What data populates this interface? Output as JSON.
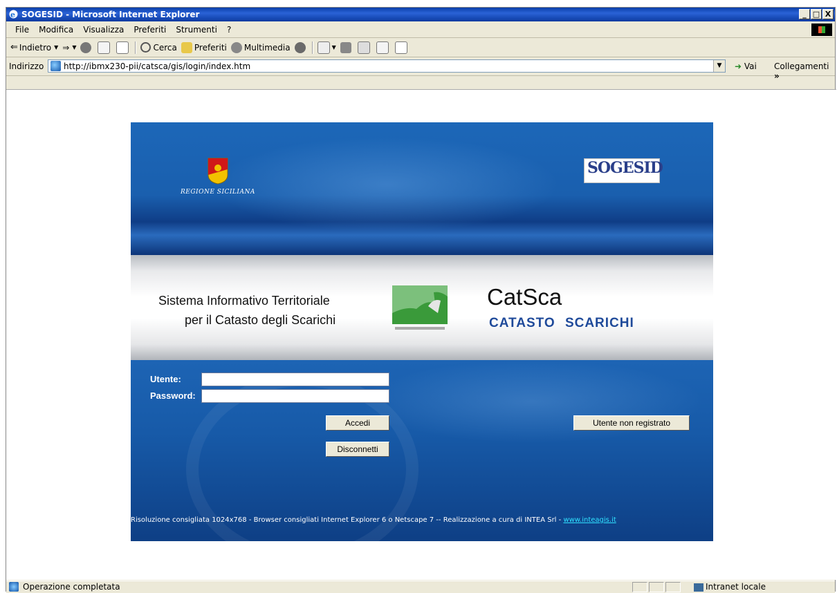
{
  "window": {
    "title": "SOGESID - Microsoft Internet Explorer",
    "controls": [
      "_",
      "□",
      "X"
    ]
  },
  "menu": [
    "File",
    "Modifica",
    "Visualizza",
    "Preferiti",
    "Strumenti",
    "?"
  ],
  "toolbar": {
    "back": "Indietro",
    "search": "Cerca",
    "favorites": "Preferiti",
    "media": "Multimedia"
  },
  "address": {
    "label": "Indirizzo",
    "url": "http://ibmx230-pii/catsca/gis/login/index.htm",
    "go": "Vai",
    "links": "Collegamenti"
  },
  "login": {
    "region_label": "REGIONE SICILIANA",
    "sogesid_logo": "SOGESID",
    "system_line1": "Sistema Informativo Territoriale",
    "system_line2": "per il Catasto degli Scarichi",
    "app_name": "CatSca",
    "app_subtitle": "CATASTO SCARICHI",
    "user_label": "Utente:",
    "password_label": "Password:",
    "user_value": "",
    "password_value": "",
    "login_button": "Accedi",
    "logout_button": "Disconnetti",
    "guest_button": "Utente non registrato",
    "footer_text": "Risoluzione consigliata 1024x768 - Browser consigliati Internet Explorer 6 o Netscape 7 -- Realizzazione a cura di INTEA Srl - ",
    "footer_link": "www.inteagis.it"
  },
  "status": {
    "text": "Operazione completata",
    "zone": "Intranet locale"
  }
}
